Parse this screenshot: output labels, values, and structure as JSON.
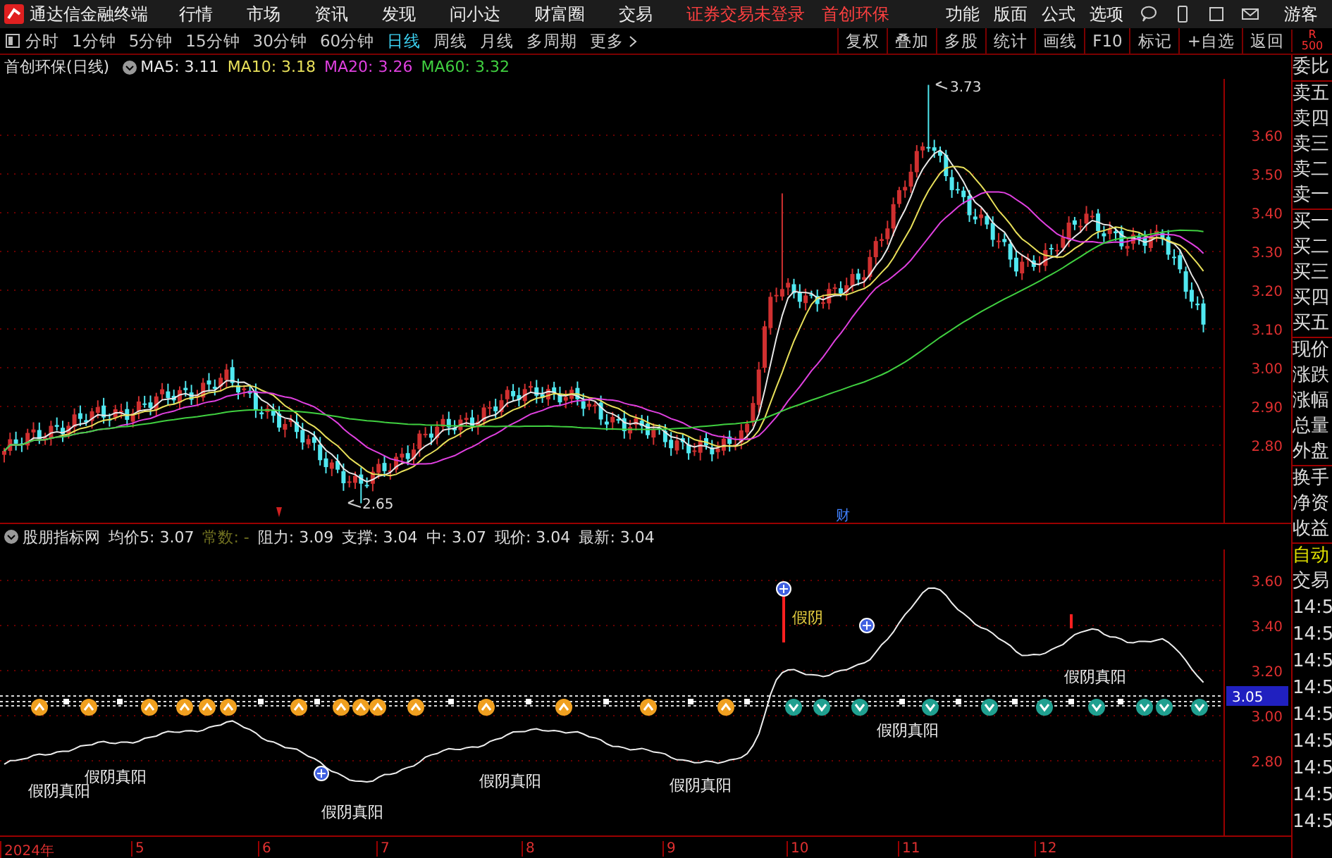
{
  "app": {
    "title": "通达信金融终端"
  },
  "menu": [
    "行情",
    "市场",
    "资讯",
    "发现",
    "问小达",
    "财富圈",
    "交易"
  ],
  "status": [
    "证券交易未登录",
    "首创环保"
  ],
  "right_menu": [
    "功能",
    "版面",
    "公式",
    "选项"
  ],
  "user": "游客",
  "periods": [
    {
      "label": "分时",
      "selected": false
    },
    {
      "label": "1分钟",
      "selected": false
    },
    {
      "label": "5分钟",
      "selected": false
    },
    {
      "label": "15分钟",
      "selected": false
    },
    {
      "label": "30分钟",
      "selected": false
    },
    {
      "label": "60分钟",
      "selected": false
    },
    {
      "label": "日线",
      "selected": true
    },
    {
      "label": "周线",
      "selected": false
    },
    {
      "label": "月线",
      "selected": false
    },
    {
      "label": "多周期",
      "selected": false
    },
    {
      "label": "更多",
      "selected": false
    }
  ],
  "tools": [
    "复权",
    "叠加",
    "多股",
    "统计",
    "画线",
    "F10",
    "标记",
    "+自选",
    "返回"
  ],
  "level_badge": {
    "letter": "R",
    "count": "500"
  },
  "main_chart": {
    "title": "首创环保(日线)",
    "ma": [
      {
        "text": "MA5: 3.11",
        "color": "#e8e8e8"
      },
      {
        "text": "MA10: 3.18",
        "color": "#e8e05a"
      },
      {
        "text": "MA20: 3.26",
        "color": "#e040e0"
      },
      {
        "text": "MA60: 3.32",
        "color": "#40d040"
      }
    ],
    "high_label": "3.73",
    "low_label": "2.65",
    "event_marker": "财",
    "price_ticks": [
      "3.60",
      "3.50",
      "3.40",
      "3.30",
      "3.20",
      "3.10",
      "3.00",
      "2.90",
      "2.80"
    ]
  },
  "indicator": {
    "name": "股朋指标网",
    "fields": [
      {
        "text": "均价5: 3.07",
        "kind": "normal"
      },
      {
        "text": "常数: -",
        "kind": "muted"
      },
      {
        "text": "阻力: 3.09",
        "kind": "normal"
      },
      {
        "text": "支撑: 3.04",
        "kind": "normal"
      },
      {
        "text": "中: 3.07",
        "kind": "normal"
      },
      {
        "text": "现价: 3.04",
        "kind": "normal"
      },
      {
        "text": "最新: 3.04",
        "kind": "normal"
      }
    ],
    "price_ticks": [
      "3.60",
      "3.40",
      "3.20",
      "3.00",
      "2.80"
    ],
    "current_price": "3.05",
    "signal_labels": [
      {
        "text": "假阴真阳",
        "kind": "normal"
      },
      {
        "text": "假阴真阳",
        "kind": "normal"
      },
      {
        "text": "假阴真阳",
        "kind": "normal"
      },
      {
        "text": "假阴真阳",
        "kind": "normal"
      },
      {
        "text": "假阴真阳",
        "kind": "normal"
      },
      {
        "text": "假阴",
        "kind": "highlight"
      },
      {
        "text": "假阴真阳",
        "kind": "normal"
      },
      {
        "text": "假阴真阳",
        "kind": "normal"
      }
    ]
  },
  "quote_panel": {
    "labels": [
      "委比",
      "卖五",
      "卖四",
      "卖三",
      "卖二",
      "卖一",
      "买一",
      "买二",
      "买三",
      "买四",
      "买五",
      "现价",
      "涨跌",
      "涨幅",
      "总量",
      "外盘",
      "换手",
      "净资",
      "收益"
    ],
    "mode": "自动",
    "trade": "交易",
    "times": [
      "14:5",
      "14:5",
      "14:5",
      "14:5",
      "14:5",
      "14:5",
      "14:5",
      "14:5",
      "14:5"
    ]
  },
  "time_axis": [
    "2024年",
    "5",
    "6",
    "7",
    "8",
    "9",
    "10",
    "11",
    "12"
  ]
}
